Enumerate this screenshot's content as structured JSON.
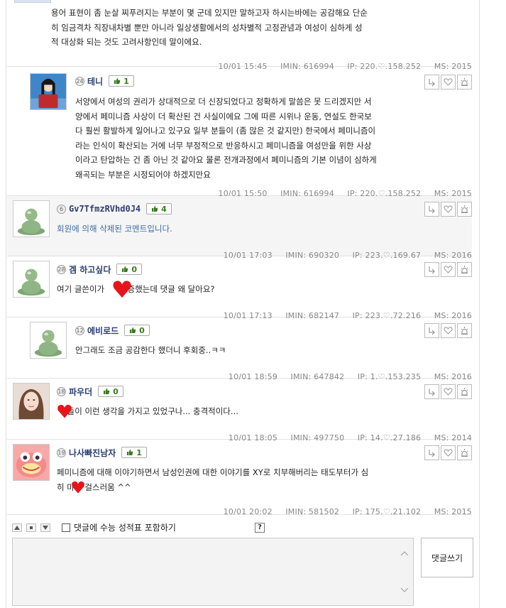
{
  "comments": [
    {
      "text": "용어 표현이 좀 눈살 찌푸려지는 부분이 몇 군데 있지만 말하고자 하시는바에는 공감해요 단순\n히 임금격차 직장내차별 뿐만 아니라 일상생활에서의 성차별적 고정관념과 여성이 심하게 성\n적 대상화 되는 것도 고려사항인데 말이에요.",
      "date": "10/01 15:45",
      "imin": "IMIN: 616994",
      "ip": "IP: 220.♡.158.252",
      "ms": "MS: 2015"
    },
    {
      "level": "24",
      "nick": "테니",
      "likes": "1",
      "text": "서양에서 여성의 권리가 상대적으로 더 신장되었다고 정확하게 말씀은 못 드리겠지만 서\n양에서 페미니즘 사상이 더 확산된 건 사실이에요 그에 따른 시위나 운동, 연설도 한국보\n다 훨씬 활발하게 일어나고 있구요 일부 분들이 (좀 많은 것 같지만) 한국에서 페미니즘이\n라는 인식이 확산되는 거에 너무 부정적으로 반응하시고 페미니즘을 여성만을 위한 사상\n이라고 탄압하는 건 좀 아닌 것 같아요 물론 전개과정에서 페미니즘의 기본 이념이 심하게\n왜곡되는 부분은 시정되어야 하겠지만요",
      "date": "10/01 15:50",
      "imin": "IMIN: 616994",
      "ip": "IP: 220.♡.158.252",
      "ms": "MS: 2015"
    },
    {
      "level": "6",
      "nick": "Gv7TfmzRVhd0J4",
      "likes": "4",
      "text": "회원에 의해 삭제된 코멘트입니다.",
      "date": "10/01 17:03",
      "imin": "IMIN: 690320",
      "ip": "IP: 223.♡.169.67",
      "ms": "MS: 2016"
    },
    {
      "level": "28",
      "nick": "겜 하고싶다",
      "likes": "0",
      "text": "여기 글쓴이가      인증했는데 댓글 왜 달아요?",
      "date": "10/01 17:13",
      "imin": "IMIN: 682147",
      "ip": "IP: 223.♡.72.216",
      "ms": "MS: 2016"
    },
    {
      "level": "12",
      "nick": "에비로드",
      "likes": "0",
      "text": "안그래도 조금 공감한다 했더니 후회중..ㅋㅋ",
      "date": "10/01 18:59",
      "imin": "IMIN: 647842",
      "ip": "IP: 1.♡.153.235",
      "ms": "MS: 2016"
    },
    {
      "level": "18",
      "nick": "파우더",
      "likes": "0",
      "text": "    들이 이런 생각을 가지고 있었구나... 충격적이다...",
      "date": "10/01 18:05",
      "imin": "IMIN: 497750",
      "ip": "IP: 14.♡.27.186",
      "ms": "MS: 2014"
    },
    {
      "level": "19",
      "nick": "나사빠진남자",
      "likes": "1",
      "text": "페미니즘에 대해 이야기하면서 남성인권에 대한 이야기를 XY로 치부해버리는 태도부터가 심\n히 마    걸스러움 ^^",
      "date": "10/01 20:02",
      "imin": "IMIN: 581502",
      "ip": "IP: 175.♡.21.102",
      "ms": "MS: 2015"
    }
  ],
  "write": {
    "checkbox_label": "댓글에 수능 성적표 포함하기",
    "help": "?",
    "submit_label": "댓글쓰기"
  },
  "colors": {
    "nick": "#2c3e72",
    "like": "#3a7a21",
    "heart": "#e8141b",
    "deleted": "#3a6ca8"
  }
}
